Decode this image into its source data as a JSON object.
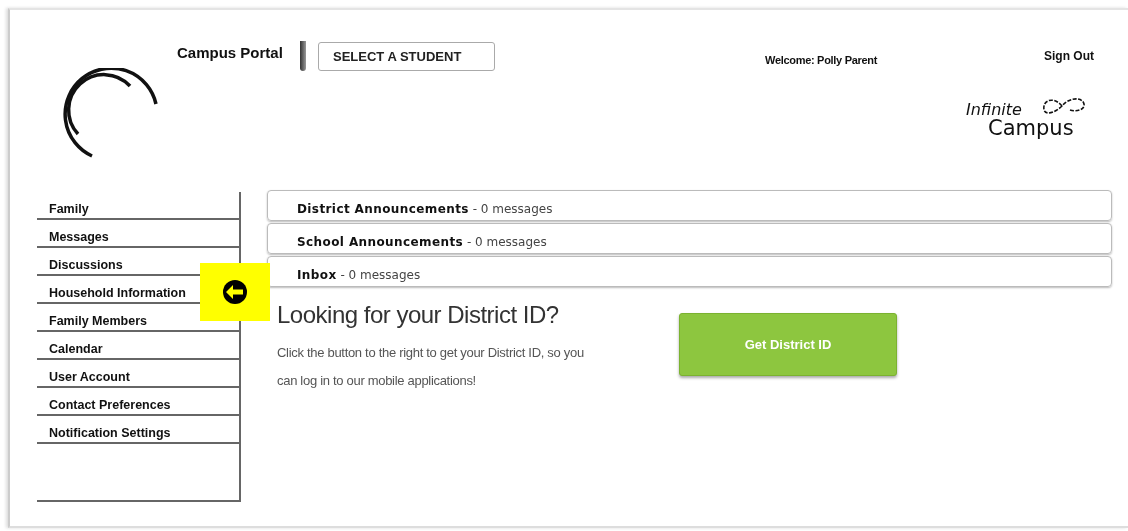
{
  "header": {
    "portal_title": "Campus Portal",
    "student_button": "SELECT A STUDENT",
    "welcome": "Welcome: Polly Parent",
    "sign_out": "Sign Out",
    "logo_line_1": "Infinite",
    "logo_line_2": "Campus"
  },
  "sidebar": {
    "items": [
      {
        "label": "Family"
      },
      {
        "label": "Messages"
      },
      {
        "label": "Discussions"
      },
      {
        "label": "Household Information"
      },
      {
        "label": "Family Members"
      },
      {
        "label": "Calendar"
      },
      {
        "label": "User Account"
      },
      {
        "label": "Contact Preferences"
      },
      {
        "label": "Notification Settings"
      }
    ]
  },
  "message_panels": [
    {
      "title": "District Announcements",
      "count": "- 0 messages"
    },
    {
      "title": "School Announcements",
      "count": "- 0 messages"
    },
    {
      "title": "Inbox",
      "count": "- 0 messages"
    }
  ],
  "district_id": {
    "heading": "Looking for your District ID?",
    "text": "Click the button to the right to get your District ID, so you can log in to our mobile applications!",
    "button": "Get District ID"
  }
}
